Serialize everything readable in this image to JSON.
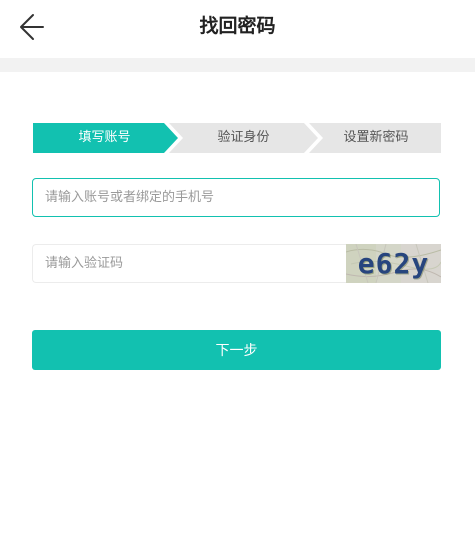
{
  "header": {
    "title": "找回密码",
    "back_icon": "arrow-left-icon"
  },
  "steps": [
    {
      "label": "填写账号",
      "active": true
    },
    {
      "label": "验证身份",
      "active": false
    },
    {
      "label": "设置新密码",
      "active": false
    }
  ],
  "form": {
    "account_placeholder": "请输入账号或者绑定的手机号",
    "account_value": "",
    "code_placeholder": "请输入验证码",
    "code_value": "",
    "captcha_text": "e62y",
    "next_label": "下一步"
  },
  "colors": {
    "accent": "#12c1b0",
    "step_inactive": "#e6e6e6",
    "title": "#222222",
    "divider": "#f2f2f2"
  }
}
